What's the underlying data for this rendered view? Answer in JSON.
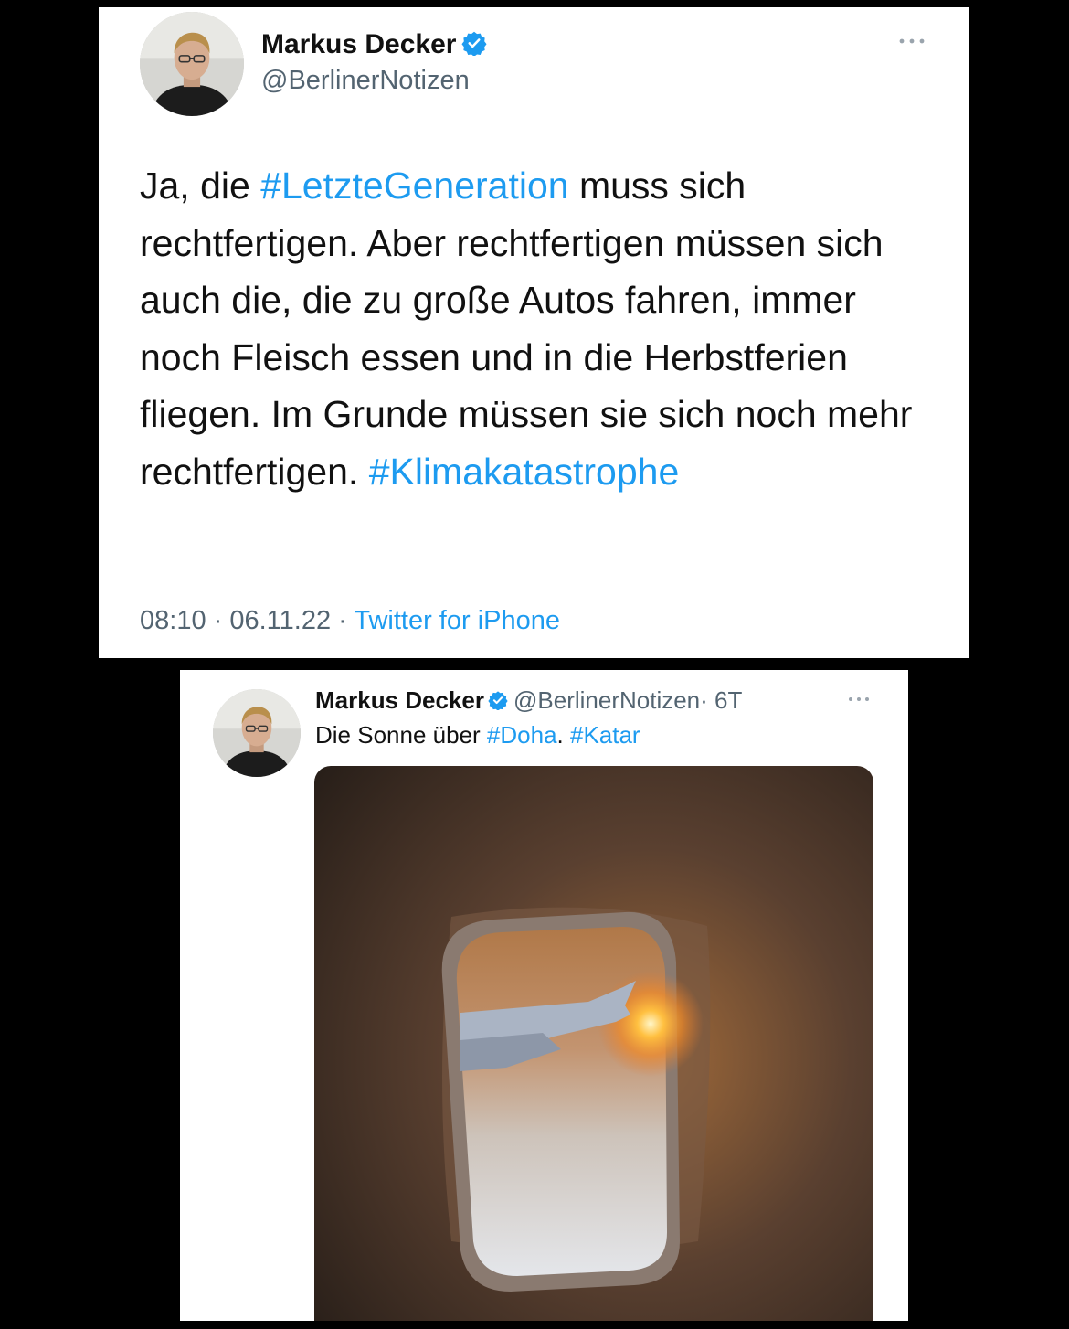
{
  "tweet1": {
    "author_name": "Markus Decker",
    "handle": "@BerlinerNotizen",
    "text_segments": [
      "Ja, die ",
      "#LetzteGeneration",
      " muss sich rechtfertigen. Aber rechtfertigen müssen sich auch die, die zu große Autos fahren, immer noch Fleisch essen und in die Herbstferien fliegen. Im Grunde müssen sie sich noch mehr rechtfertigen. ",
      "#Klimakatastrophe"
    ],
    "time": "08:10",
    "date": "06.11.22",
    "separator": " · ",
    "source": "Twitter for iPhone",
    "icons": [
      "avatar-photo",
      "verified-badge-icon",
      "more-options-icon"
    ]
  },
  "tweet2": {
    "author_name": "Markus Decker",
    "handle": "@BerlinerNotizen",
    "age": "· 6T",
    "text_prefix": "Die Sonne über ",
    "hashtag1": "#Doha",
    "text_middle": ". ",
    "hashtag2": "#Katar",
    "image": "airplane-window-sunset-photo",
    "icons": [
      "avatar-photo",
      "verified-badge-icon",
      "more-options-icon"
    ]
  },
  "colors": {
    "background": "#000000",
    "card": "#ffffff",
    "link": "#1d9bf0",
    "muted": "#536471",
    "text": "#111111"
  }
}
